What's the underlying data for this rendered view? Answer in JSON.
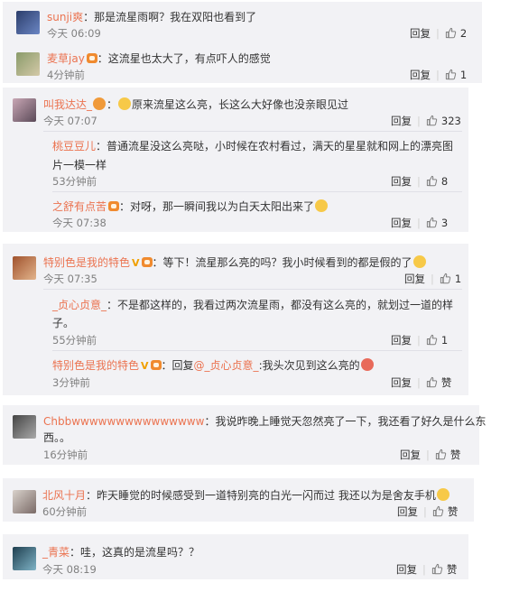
{
  "labels": {
    "reply": "回复",
    "like": "赞"
  },
  "comments": [
    {
      "user": "sunji爽",
      "text": "：那是流星雨啊？我在双阳也看到了",
      "time": "今天 06:09",
      "likes": "2"
    },
    {
      "user": "麦草jay",
      "text": "：这流星也太大了，有点吓人的感觉",
      "time": "4分钟前",
      "likes": "1"
    },
    {
      "user": "叫我达达_",
      "text": "原来流星这么亮，长这么大好像也没亲眼见过",
      "time": "今天 07:07",
      "likes": "323",
      "replies": [
        {
          "user": "桃豆豆儿",
          "text_1": "：普通流星没这么亮哒，小时候在农村看过，满天的星星就和网上的漂亮图",
          "text_2": "片一模一样",
          "time": "53分钟前",
          "likes": "8"
        },
        {
          "user": "之舒有点苦",
          "text": "：对呀，那一瞬间我以为白天太阳出来了",
          "time": "今天 07:38",
          "likes": "3"
        }
      ]
    },
    {
      "user": "特别色是我的特色",
      "text": "：等下！流星那么亮的吗？我小时候看到的都是假的了",
      "time": "今天 07:35",
      "likes": "1",
      "replies": [
        {
          "user": "_贞心贞意_",
          "text_1": "：不是都这样的，我看过两次流星雨，都没有这么亮的，就划过一道的样",
          "text_2": "子。",
          "time": "55分钟前",
          "likes": "1"
        },
        {
          "user": "特别色是我的特色",
          "text_pre": "：回复",
          "mention": "@_贞心贞意_",
          "text": ":我头次见到这么亮的",
          "time": "3分钟前",
          "likes": "赞"
        }
      ]
    },
    {
      "user": "Chbbwwwwwwwwwwwwwww",
      "text_1": "：我说昨晚上睡觉天忽然亮了一下，我还看了好久是什么东",
      "text_2": "西。。",
      "time": "16分钟前",
      "likes": "赞"
    },
    {
      "user": "北风十月",
      "text": "：昨天睡觉的时候感受到一道特别亮的白光一闪而过 我还以为是舍友手机",
      "time": "60分钟前",
      "likes": "赞"
    },
    {
      "user": "_青菜",
      "text": "：哇，这真的是流星吗？？",
      "time": "今天 08:19",
      "likes": "赞"
    }
  ]
}
